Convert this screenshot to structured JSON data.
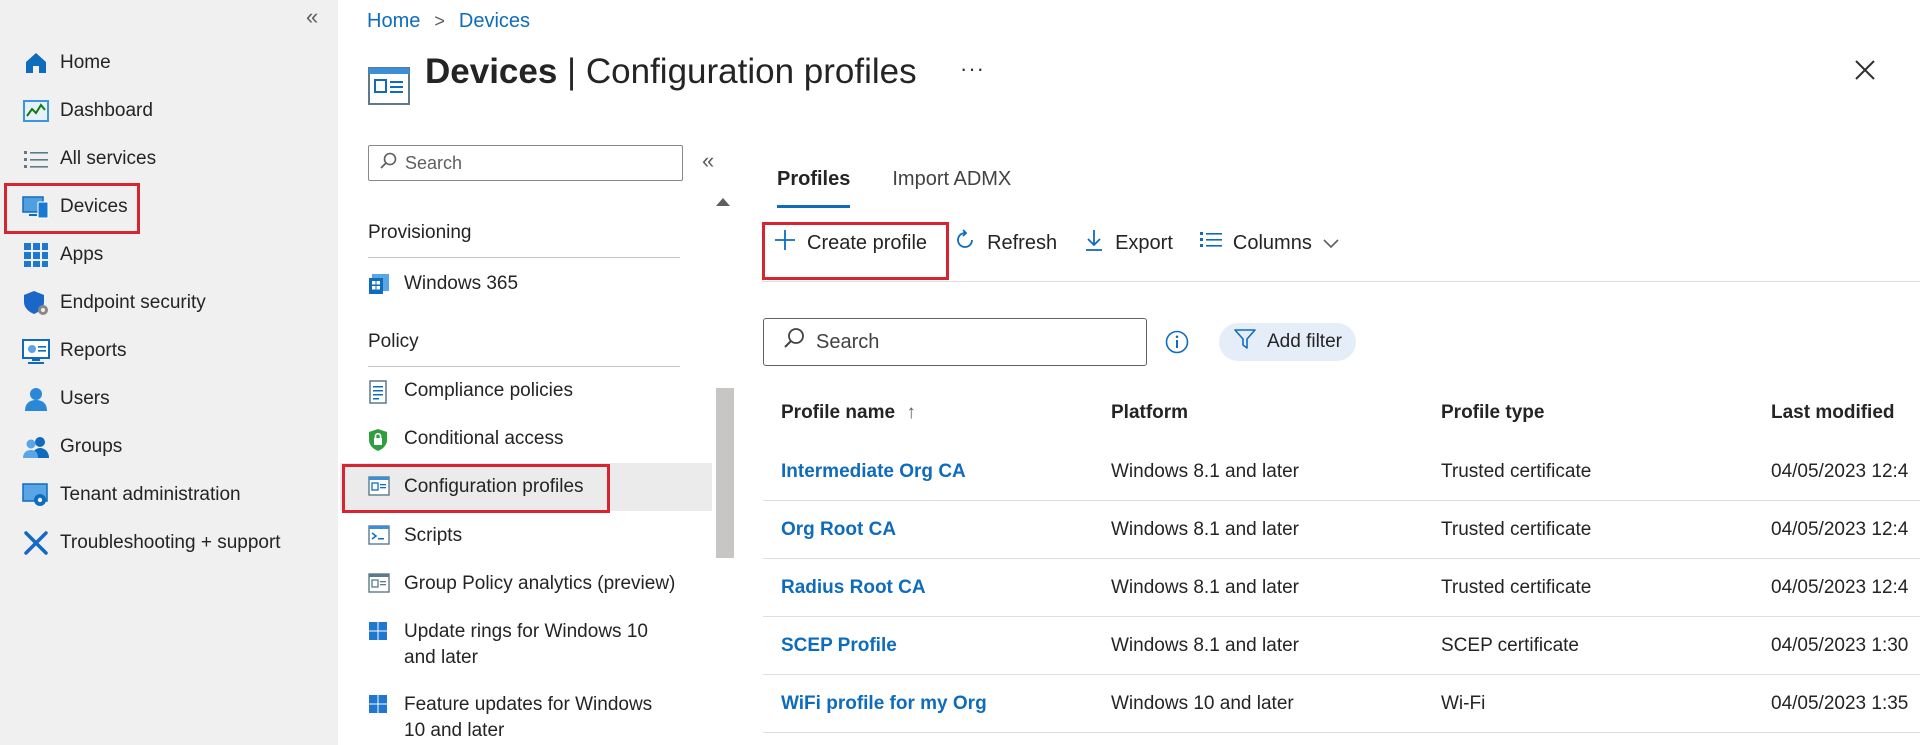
{
  "nav": {
    "items": [
      {
        "label": "Home",
        "icon": "home-icon"
      },
      {
        "label": "Dashboard",
        "icon": "dashboard-icon"
      },
      {
        "label": "All services",
        "icon": "list-icon"
      },
      {
        "label": "Devices",
        "icon": "devices-icon"
      },
      {
        "label": "Apps",
        "icon": "apps-grid-icon"
      },
      {
        "label": "Endpoint security",
        "icon": "shield-gear-icon"
      },
      {
        "label": "Reports",
        "icon": "reports-icon"
      },
      {
        "label": "Users",
        "icon": "user-icon"
      },
      {
        "label": "Groups",
        "icon": "groups-icon"
      },
      {
        "label": "Tenant administration",
        "icon": "tenant-gear-icon"
      },
      {
        "label": "Troubleshooting + support",
        "icon": "wrench-icon"
      }
    ],
    "collapse_glyph": "«"
  },
  "breadcrumb": {
    "home": "Home",
    "devices": "Devices",
    "sep": ">"
  },
  "header": {
    "title_bold": "Devices",
    "title_sep": " | ",
    "title_rest": "Configuration profiles",
    "more": "···"
  },
  "midpanel": {
    "search_placeholder": "Search",
    "collapse_glyph": "«",
    "sections": {
      "provisioning": "Provisioning",
      "policy": "Policy"
    },
    "items": {
      "windows365": "Windows 365",
      "compliance": "Compliance policies",
      "conditional": "Conditional access",
      "configuration": "Configuration profiles",
      "scripts": "Scripts",
      "gpa": "Group Policy analytics (preview)",
      "update_rings_1": "Update rings for Windows 10",
      "update_rings_2": "and later",
      "feature_updates_1": "Feature updates for Windows",
      "feature_updates_2": "10 and later"
    }
  },
  "tabs": {
    "profiles": "Profiles",
    "import": "Import ADMX"
  },
  "toolbar": {
    "create": "Create profile",
    "refresh": "Refresh",
    "export": "Export",
    "columns": "Columns"
  },
  "filter": {
    "search_placeholder": "Search",
    "add_filter": "Add filter"
  },
  "table": {
    "headers": {
      "name": "Profile name",
      "sort": "↑",
      "platform": "Platform",
      "type": "Profile type",
      "modified": "Last modified"
    },
    "rows": [
      {
        "name": "Intermediate Org CA",
        "platform": "Windows 8.1 and later",
        "type": "Trusted certificate",
        "modified": "04/05/2023 12:4"
      },
      {
        "name": "Org Root CA",
        "platform": "Windows 8.1 and later",
        "type": "Trusted certificate",
        "modified": "04/05/2023 12:4"
      },
      {
        "name": "Radius Root CA",
        "platform": "Windows 8.1 and later",
        "type": "Trusted certificate",
        "modified": "04/05/2023 12:4"
      },
      {
        "name": "SCEP Profile",
        "platform": "Windows 8.1 and later",
        "type": "SCEP certificate",
        "modified": "04/05/2023 1:30"
      },
      {
        "name": "WiFi profile for my Org",
        "platform": "Windows 10 and later",
        "type": "Wi-Fi",
        "modified": "04/05/2023 1:35"
      }
    ]
  },
  "colors": {
    "accent": "#0f6cbd",
    "highlight": "#d62430",
    "nav_bg": "#f0f0f0"
  }
}
